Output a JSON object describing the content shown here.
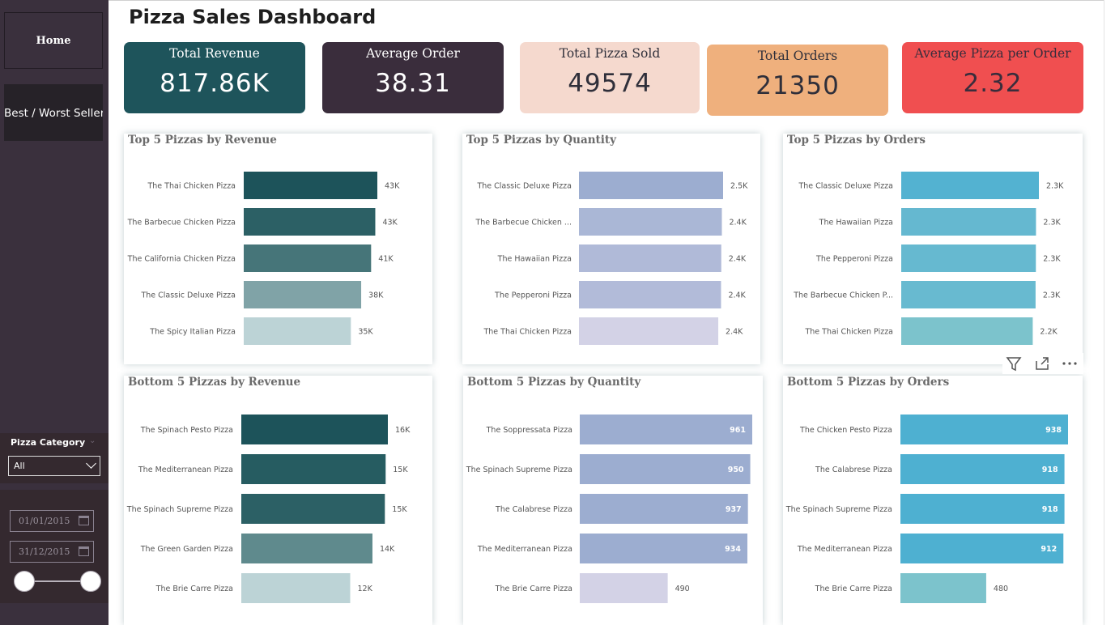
{
  "title": "Pizza Sales Dashboard",
  "nav": {
    "home": "Home",
    "best": "Best / Worst Seller"
  },
  "filters": {
    "category_title": "Pizza Category",
    "category_value": "All",
    "start_date": "01/01/2015",
    "end_date": "31/12/2015"
  },
  "kpis": [
    {
      "label": "Total Revenue",
      "value": "817.86K",
      "bg": "#1e545b",
      "fg": "#ffffff"
    },
    {
      "label": "Average Order",
      "value": "38.31",
      "bg": "#3a2d3c",
      "fg": "#ffffff"
    },
    {
      "label": "Total Pizza Sold",
      "value": "49574",
      "bg": "#f5d9ce",
      "fg": "#2f2f3a"
    },
    {
      "label": "Total Orders",
      "value": "21350",
      "bg": "#efb07d",
      "fg": "#2f2f3a"
    },
    {
      "label": "Average Pizza per Order",
      "value": "2.32",
      "bg": "#f04f50",
      "fg": "#3a2d3c"
    }
  ],
  "chart_data": [
    {
      "type": "bar",
      "orientation": "horizontal",
      "title": "Top 5 Pizzas by Revenue",
      "categories": [
        "The Thai Chicken Pizza",
        "The Barbecue Chicken Pizza",
        "The California Chicken Pizza",
        "The Classic Deluxe Pizza",
        "The Spicy Italian Pizza"
      ],
      "values": [
        43434,
        42768,
        41410,
        38181,
        34831
      ],
      "labels": [
        "43K",
        "43K",
        "41K",
        "38K",
        "35K"
      ],
      "colors": [
        "#1d535a",
        "#2c6065",
        "#467579",
        "#80a3a7",
        "#bcd3d6"
      ],
      "label_inside": false
    },
    {
      "type": "bar",
      "orientation": "horizontal",
      "title": "Top 5 Pizzas by Quantity",
      "categories": [
        "The Classic Deluxe Pizza",
        "The Barbecue Chicken ...",
        "The Hawaiian Pizza",
        "The Pepperoni Pizza",
        "The Thai Chicken Pizza"
      ],
      "values": [
        2453,
        2432,
        2422,
        2418,
        2371
      ],
      "labels": [
        "2.5K",
        "2.4K",
        "2.4K",
        "2.4K",
        "2.4K"
      ],
      "colors": [
        "#9cadd0",
        "#aab7d6",
        "#b0bad8",
        "#b2bbd9",
        "#d3d2e6"
      ],
      "label_inside": false
    },
    {
      "type": "bar",
      "orientation": "horizontal",
      "title": "Top 5 Pizzas by Orders",
      "categories": [
        "The Classic Deluxe Pizza",
        "The Hawaiian Pizza",
        "The Pepperoni Pizza",
        "The Barbecue Chicken P...",
        "The Thai Chicken Pizza"
      ],
      "values": [
        2329,
        2280,
        2278,
        2273,
        2225
      ],
      "labels": [
        "2.3K",
        "2.3K",
        "2.3K",
        "2.3K",
        "2.2K"
      ],
      "colors": [
        "#53b2d1",
        "#65b8d0",
        "#66b9d0",
        "#68bad0",
        "#7cc3cc"
      ],
      "label_inside": false
    },
    {
      "type": "bar",
      "orientation": "horizontal",
      "title": "Bottom 5 Pizzas by Revenue",
      "categories": [
        "The Spinach Pesto Pizza",
        "The Mediterranean Pizza",
        "The Spinach Supreme Pizza",
        "The Green Garden Pizza",
        "The Brie Carre Pizza"
      ],
      "values": [
        15596,
        15360,
        15277,
        13956,
        11588
      ],
      "labels": [
        "16K",
        "15K",
        "15K",
        "14K",
        "12K"
      ],
      "colors": [
        "#1d535a",
        "#265c61",
        "#2c6065",
        "#5f8a8d",
        "#bcd3d6"
      ],
      "label_inside": false
    },
    {
      "type": "bar",
      "orientation": "horizontal",
      "title": "Bottom 5 Pizzas by Quantity",
      "categories": [
        "The Soppressata Pizza",
        "The Spinach Supreme Pizza",
        "The Calabrese Pizza",
        "The Mediterranean Pizza",
        "The Brie Carre Pizza"
      ],
      "values": [
        961,
        950,
        937,
        934,
        490
      ],
      "labels": [
        "961",
        "950",
        "937",
        "934",
        "490"
      ],
      "colors": [
        "#9cadd0",
        "#9cadd0",
        "#9cadd0",
        "#9cadd0",
        "#d3d2e6"
      ],
      "label_inside": [
        true,
        true,
        true,
        true,
        false
      ]
    },
    {
      "type": "bar",
      "orientation": "horizontal",
      "title": "Bottom 5 Pizzas by Orders",
      "categories": [
        "The Chicken Pesto Pizza",
        "The Calabrese Pizza",
        "The Spinach Supreme Pizza",
        "The Mediterranean Pizza",
        "The Brie Carre Pizza"
      ],
      "values": [
        938,
        918,
        918,
        912,
        480
      ],
      "labels": [
        "938",
        "918",
        "918",
        "912",
        "480"
      ],
      "colors": [
        "#4eb0d1",
        "#4eb0d1",
        "#4eb0d1",
        "#4eb0d1",
        "#7cc3cc"
      ],
      "label_inside": [
        true,
        true,
        true,
        true,
        false
      ]
    }
  ]
}
